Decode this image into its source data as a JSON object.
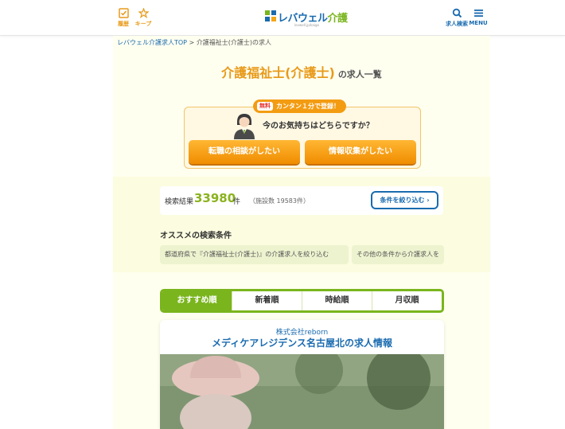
{
  "header": {
    "history_label": "履歴",
    "keep_label": "キープ",
    "logo_text_main": "レバウェル",
    "logo_text_kaigo": "介護",
    "logo_sub": "levwell.jp/kaigo",
    "search_label": "求人検索",
    "menu_label": "MENU"
  },
  "breadcrumb": {
    "home": "レバウェル介護求人TOP",
    "separator": " > ",
    "current": "介護福祉士(介護士)の求人"
  },
  "page_title": {
    "main": "介護福祉士(介護士)",
    "suffix": "の求人一覧"
  },
  "consult": {
    "free_badge": "無料",
    "badge_text": "カンタン１分で登録！",
    "question": "今のお気持ちはどちらですか？",
    "btn_change_job": "転職の相談がしたい",
    "btn_info": "情報収集がしたい"
  },
  "results": {
    "label": "検索結果",
    "count": "33980",
    "unit": "件",
    "sub": "（施設数 19583件）",
    "narrow_button": "条件を絞り込む"
  },
  "recommend": {
    "title": "オススメの検索条件",
    "chips": [
      "都道府県で『介護福祉士(介護士)』の介護求人を絞り込む",
      "その他の条件から介護求人を"
    ]
  },
  "sort_tabs": [
    "おすすめ順",
    "新着順",
    "時給順",
    "月収順"
  ],
  "job": {
    "company": "株式会社reborn",
    "title": "メディケアレジデンス名古屋北の求人情報"
  },
  "colors": {
    "accent_orange": "#e89a1a",
    "brand_blue": "#1a6bb0",
    "brand_green": "#7ab51d"
  }
}
